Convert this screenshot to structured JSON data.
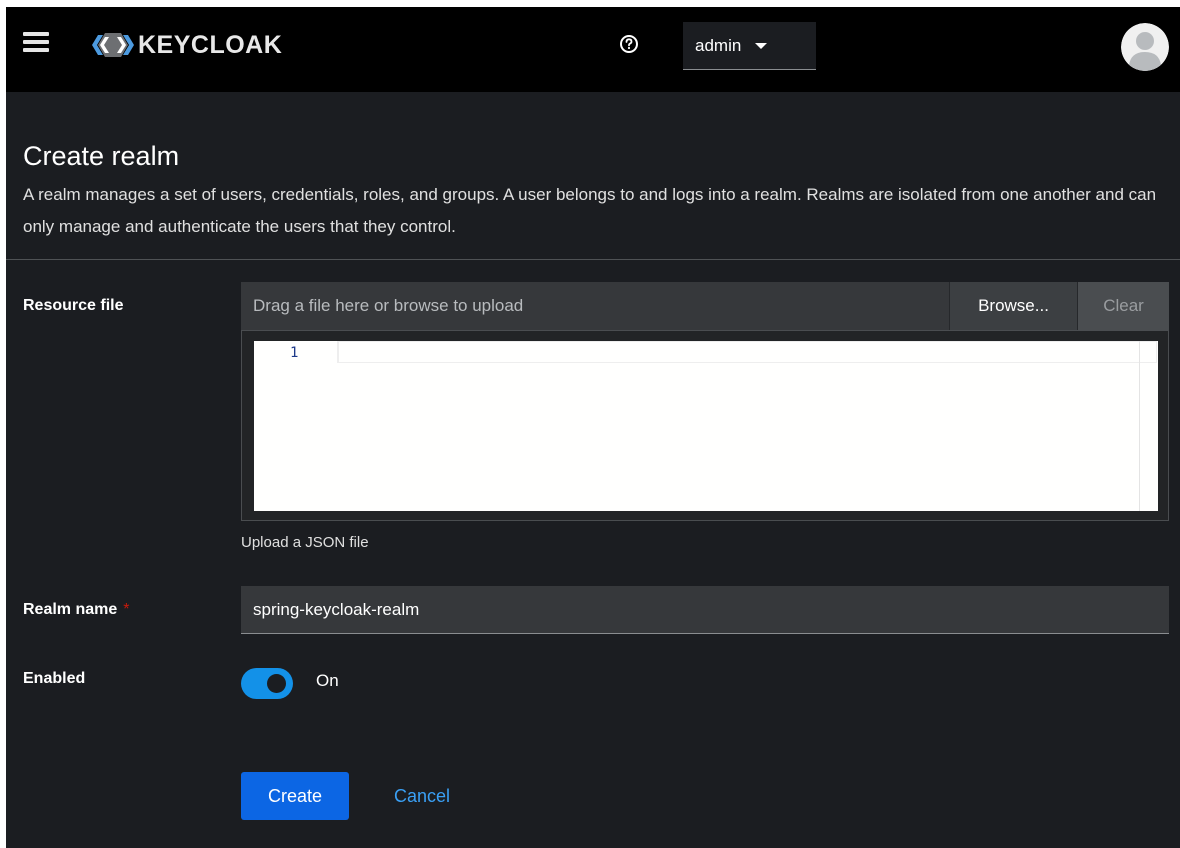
{
  "header": {
    "brand": "KEYCLOAK",
    "user_menu_label": "admin",
    "icons": {
      "menu": "hamburger-menu-icon",
      "help": "question-circle-icon",
      "dropdown": "caret-down-icon",
      "avatar": "user-avatar-icon"
    }
  },
  "page": {
    "title": "Create realm",
    "description": "A realm manages a set of users, credentials, roles, and groups. A user belongs to and logs into a realm. Realms are isolated from one another and can only manage and authenticate the users that they control."
  },
  "form": {
    "resource_file": {
      "label": "Resource file",
      "placeholder": "Drag a file here or browse to upload",
      "browse_label": "Browse...",
      "clear_label": "Clear",
      "editor_line_number": "1",
      "helper_text": "Upload a JSON file"
    },
    "realm_name": {
      "label": "Realm name",
      "required_marker": "*",
      "value": "spring-keycloak-realm"
    },
    "enabled": {
      "label": "Enabled",
      "state_label": "On",
      "checked": true
    },
    "actions": {
      "create_label": "Create",
      "cancel_label": "Cancel"
    }
  },
  "colors": {
    "masthead": "#000000",
    "page_bg": "#1b1d21",
    "primary": "#0c66e4",
    "switch_on": "#1391e8",
    "link": "#3aa0f5",
    "required": "#c9190b"
  }
}
